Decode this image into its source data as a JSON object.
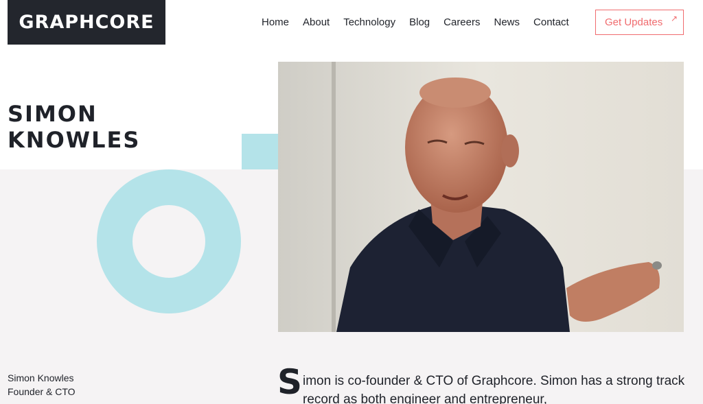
{
  "header": {
    "logo_text": "GRAPHCORE",
    "nav": [
      "Home",
      "About",
      "Technology",
      "Blog",
      "Careers",
      "News",
      "Contact"
    ],
    "cta_label": "Get Updates",
    "cta_icon": "external-arrow-icon"
  },
  "profile": {
    "heading": "SIMON\nKNOWLES",
    "photo_alt": "Simon Knowles",
    "caption_name": "Simon Knowles",
    "caption_role": "Founder & CTO",
    "bio_dropcap": "S",
    "bio_text": "imon is co-founder & CTO of Graphcore. Simon has a strong track record as both engineer and entrepreneur,"
  },
  "colors": {
    "accent_teal": "#b4e3e9",
    "cta_coral": "#f06b6e",
    "logo_bg": "#23262d"
  }
}
